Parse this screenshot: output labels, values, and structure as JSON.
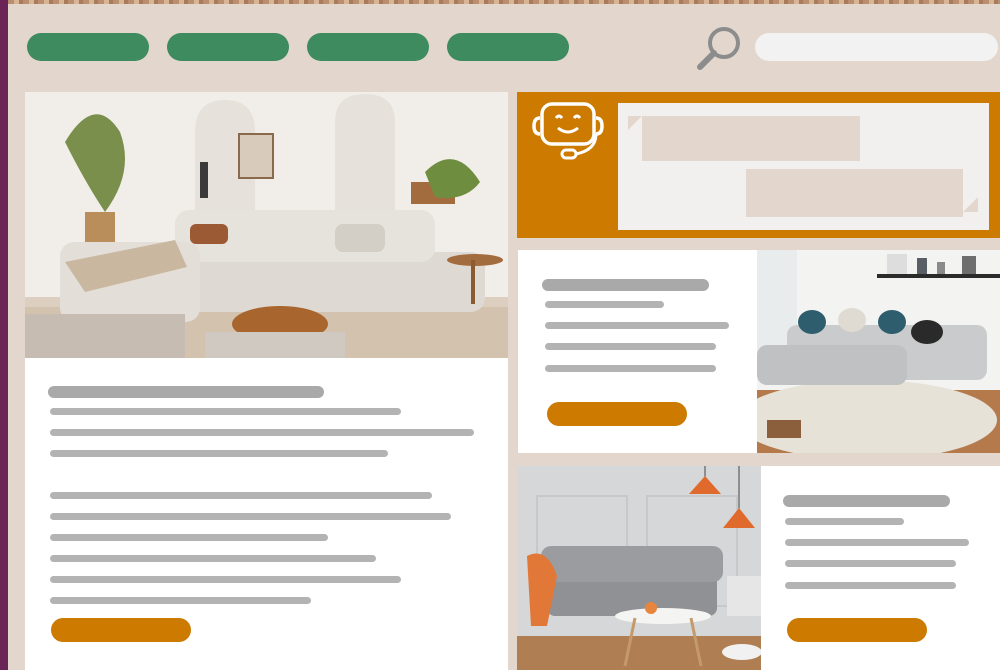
{
  "colors": {
    "background": "#e2d6cd",
    "nav_green": "#3d8b5e",
    "accent_orange": "#cc7a00",
    "left_strip": "#6a2456",
    "placeholder_gray": "#b3b3b3",
    "card_white": "#ffffff",
    "chat_box": "#f2f0ef"
  },
  "nav": {
    "items": [
      {
        "label": ""
      },
      {
        "label": ""
      },
      {
        "label": ""
      },
      {
        "label": ""
      }
    ]
  },
  "search": {
    "placeholder": "",
    "icon": "search-icon"
  },
  "chat": {
    "icon": "support-bot-icon",
    "bubbles": [
      {
        "from": "bot",
        "text": ""
      },
      {
        "from": "user",
        "text": ""
      }
    ]
  },
  "main_card": {
    "image": "living-room-beige-sofa-photo",
    "button_label": ""
  },
  "card_top_right": {
    "image": "living-room-grey-sectional-photo",
    "button_label": ""
  },
  "card_bottom_right": {
    "image": "living-room-grey-sofa-orange-lamps-photo",
    "button_label": ""
  }
}
